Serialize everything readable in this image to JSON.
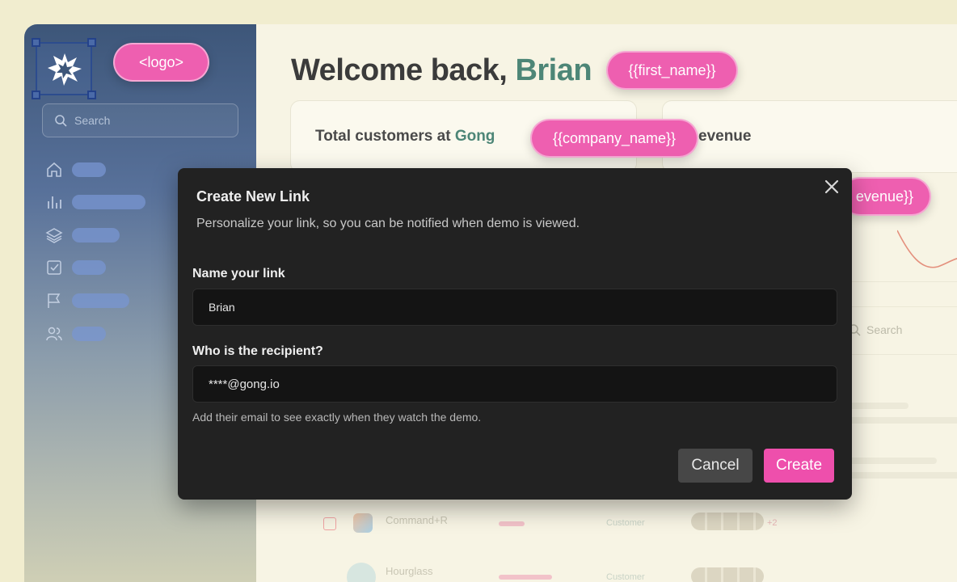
{
  "sidebar": {
    "logo_tag": "<logo>",
    "search_placeholder": "Search",
    "nav_icons": [
      "home-icon",
      "bar-chart-icon",
      "layers-icon",
      "checkbox-icon",
      "flag-icon",
      "users-icon"
    ]
  },
  "header": {
    "welcome_prefix": "Welcome back,",
    "first_name": "Brian",
    "first_name_tag": "{{first_name}}"
  },
  "cards": {
    "customers_title_prefix": "Total customers at",
    "company": "Gong",
    "company_tag": "{{company_name}}",
    "revenue_title_partial": "evenue",
    "revenue_tag_partial": "evenue}}"
  },
  "table": {
    "search_placeholder": "Search",
    "rows": [
      {
        "name": "Command+R",
        "status": "Customer",
        "extra": "+2"
      },
      {
        "name": "Hourglass",
        "status": "Customer"
      }
    ]
  },
  "modal": {
    "title": "Create New Link",
    "subtitle": "Personalize your link, so you can be notified when demo is viewed.",
    "name_label": "Name your link",
    "name_value": "Brian",
    "recipient_label": "Who is the recipient?",
    "recipient_value": "****@gong.io",
    "help": "Add their email to see exactly when they watch the demo.",
    "cancel": "Cancel",
    "create": "Create"
  },
  "colors": {
    "accent_pink": "#ee4fac",
    "brand_green": "#4d8677",
    "modal_bg": "#222222",
    "sidebar_blue": "#3d5679"
  }
}
